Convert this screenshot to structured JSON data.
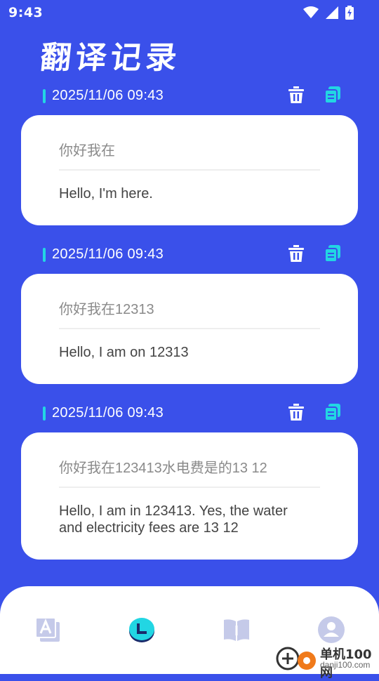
{
  "status_bar": {
    "time": "9:43"
  },
  "page": {
    "title": "翻译记录"
  },
  "records": [
    {
      "date": "2025/11/06 09:43",
      "source": "你好我在",
      "translation": "Hello, I'm here."
    },
    {
      "date": "2025/11/06 09:43",
      "source": "你好我在12313",
      "translation": "Hello, I am on 12313"
    },
    {
      "date": "2025/11/06 09:43",
      "source": "你好我在123413水电费是的13 12",
      "translation": "Hello, I am in 123413. Yes, the water and electricity fees are 13 12"
    }
  ],
  "nav": {
    "items": [
      {
        "icon": "translate-icon",
        "active": false
      },
      {
        "icon": "history-clock-icon",
        "active": true
      },
      {
        "icon": "book-icon",
        "active": false
      },
      {
        "icon": "user-icon",
        "active": false
      }
    ]
  },
  "watermark": {
    "name": "单机100网",
    "domain": "danji100.com"
  },
  "colors": {
    "background": "#3a50ea",
    "accent": "#22d6e3",
    "card": "#ffffff",
    "nav_inactive": "#c5cae9"
  }
}
